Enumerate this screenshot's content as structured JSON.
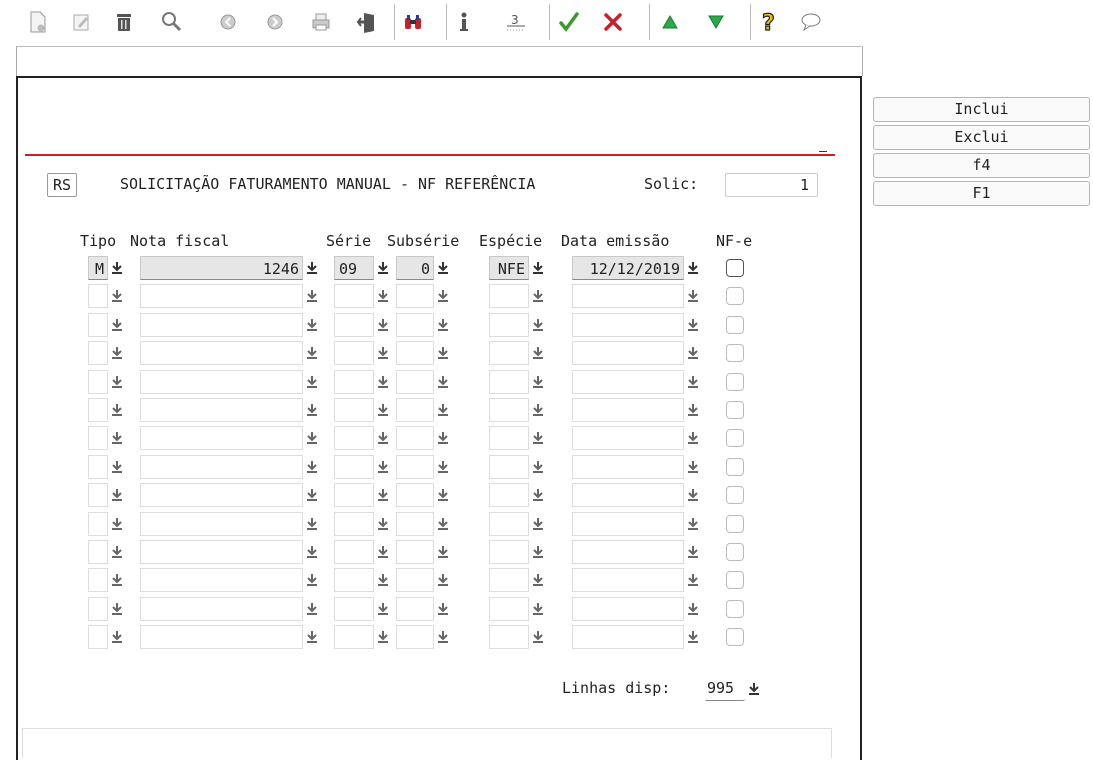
{
  "toolbar": {
    "icons": [
      "new-document-icon",
      "edit-icon",
      "trash-icon",
      "search-icon",
      "previous-icon",
      "next-icon",
      "print-icon",
      "exit-door-icon",
      "binoculars-icon",
      "info-icon",
      "numbered-list-icon",
      "check-icon",
      "cancel-x-icon",
      "up-triangle-icon",
      "down-triangle-icon",
      "help-question-icon",
      "comment-bubble-icon"
    ]
  },
  "header": {
    "state": "RS",
    "title": "SOLICITAÇÃO FATURAMENTO MANUAL - NF REFERÊNCIA",
    "solic_label": "Solic:",
    "solic_value": "1"
  },
  "table": {
    "columns": [
      "Tipo",
      "Nota fiscal",
      "Série",
      "Subsérie",
      "Espécie",
      "Data emissão",
      "NF-e"
    ],
    "rows": [
      {
        "tipo": "M",
        "nota_fiscal": "1246",
        "serie": "09",
        "subserie": "0",
        "especie": "NFE",
        "data_emissao": "12/12/2019",
        "nfe": false
      },
      {
        "tipo": "",
        "nota_fiscal": "",
        "serie": "",
        "subserie": "",
        "especie": "",
        "data_emissao": "",
        "nfe": false
      },
      {
        "tipo": "",
        "nota_fiscal": "",
        "serie": "",
        "subserie": "",
        "especie": "",
        "data_emissao": "",
        "nfe": false
      },
      {
        "tipo": "",
        "nota_fiscal": "",
        "serie": "",
        "subserie": "",
        "especie": "",
        "data_emissao": "",
        "nfe": false
      },
      {
        "tipo": "",
        "nota_fiscal": "",
        "serie": "",
        "subserie": "",
        "especie": "",
        "data_emissao": "",
        "nfe": false
      },
      {
        "tipo": "",
        "nota_fiscal": "",
        "serie": "",
        "subserie": "",
        "especie": "",
        "data_emissao": "",
        "nfe": false
      },
      {
        "tipo": "",
        "nota_fiscal": "",
        "serie": "",
        "subserie": "",
        "especie": "",
        "data_emissao": "",
        "nfe": false
      },
      {
        "tipo": "",
        "nota_fiscal": "",
        "serie": "",
        "subserie": "",
        "especie": "",
        "data_emissao": "",
        "nfe": false
      },
      {
        "tipo": "",
        "nota_fiscal": "",
        "serie": "",
        "subserie": "",
        "especie": "",
        "data_emissao": "",
        "nfe": false
      },
      {
        "tipo": "",
        "nota_fiscal": "",
        "serie": "",
        "subserie": "",
        "especie": "",
        "data_emissao": "",
        "nfe": false
      },
      {
        "tipo": "",
        "nota_fiscal": "",
        "serie": "",
        "subserie": "",
        "especie": "",
        "data_emissao": "",
        "nfe": false
      },
      {
        "tipo": "",
        "nota_fiscal": "",
        "serie": "",
        "subserie": "",
        "especie": "",
        "data_emissao": "",
        "nfe": false
      },
      {
        "tipo": "",
        "nota_fiscal": "",
        "serie": "",
        "subserie": "",
        "especie": "",
        "data_emissao": "",
        "nfe": false
      },
      {
        "tipo": "",
        "nota_fiscal": "",
        "serie": "",
        "subserie": "",
        "especie": "",
        "data_emissao": "",
        "nfe": false
      }
    ]
  },
  "footer": {
    "linhas_label": "Linhas disp:",
    "linhas_value": "995"
  },
  "side_buttons": [
    "Inclui",
    "Exclui",
    "f4",
    "F1"
  ],
  "colors": {
    "accent_line": "#c8202a",
    "filled_field": "#e6e6e6"
  }
}
